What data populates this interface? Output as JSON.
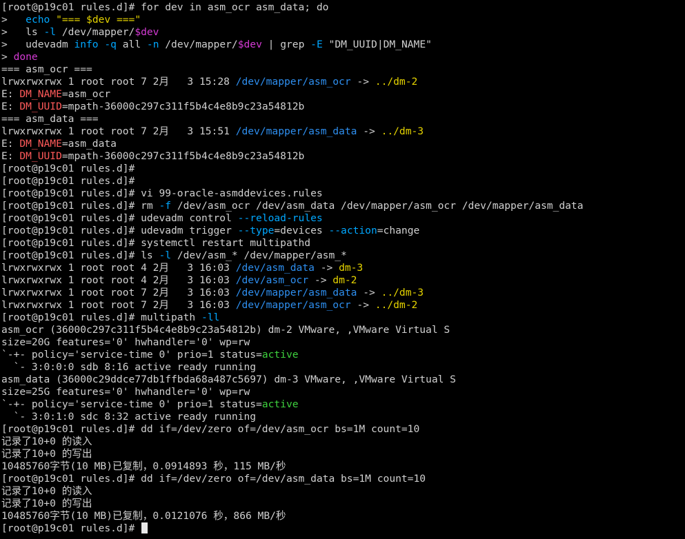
{
  "terminal": {
    "colors": {
      "background": "#000000",
      "default": "#d0d0d0",
      "cyan": "#00a7ff",
      "yellow": "#e6d400",
      "magenta": "#d43bd4",
      "red": "#ff5a5a",
      "green": "#3ed23e",
      "path": "#2e8ff0"
    },
    "lines": [
      [
        {
          "t": "[root@p19c01 rules.d]# for dev in asm_ocr asm_data; do",
          "c": "default"
        }
      ],
      [
        {
          "t": ">   ",
          "c": "default"
        },
        {
          "t": "echo",
          "c": "cyan"
        },
        {
          "t": " ",
          "c": "default"
        },
        {
          "t": "\"=== $dev ===\"",
          "c": "yellow"
        }
      ],
      [
        {
          "t": ">   ls ",
          "c": "default"
        },
        {
          "t": "-l",
          "c": "cyan"
        },
        {
          "t": " /dev/mapper/",
          "c": "default"
        },
        {
          "t": "$dev",
          "c": "magenta"
        }
      ],
      [
        {
          "t": ">   udevadm ",
          "c": "default"
        },
        {
          "t": "info",
          "c": "cyan"
        },
        {
          "t": " ",
          "c": "default"
        },
        {
          "t": "-q",
          "c": "cyan"
        },
        {
          "t": " all ",
          "c": "default"
        },
        {
          "t": "-n",
          "c": "cyan"
        },
        {
          "t": " /dev/mapper/",
          "c": "default"
        },
        {
          "t": "$dev",
          "c": "magenta"
        },
        {
          "t": " | grep ",
          "c": "default"
        },
        {
          "t": "-E",
          "c": "cyan"
        },
        {
          "t": " \"DM_UUID|DM_NAME\"",
          "c": "default"
        }
      ],
      [
        {
          "t": "> ",
          "c": "default"
        },
        {
          "t": "done",
          "c": "magenta"
        }
      ],
      [
        {
          "t": "=== asm_ocr ===",
          "c": "default"
        }
      ],
      [
        {
          "t": "lrwxrwxrwx 1 root root 7 2月   3 15:28 ",
          "c": "default"
        },
        {
          "t": "/dev/mapper/asm_ocr",
          "c": "path"
        },
        {
          "t": " -> ",
          "c": "default"
        },
        {
          "t": "../dm-2",
          "c": "yellow"
        }
      ],
      [
        {
          "t": "E: ",
          "c": "default"
        },
        {
          "t": "DM_NAME",
          "c": "red"
        },
        {
          "t": "=asm_ocr",
          "c": "default"
        }
      ],
      [
        {
          "t": "E: ",
          "c": "default"
        },
        {
          "t": "DM_UUID",
          "c": "red"
        },
        {
          "t": "=mpath-36000c297c311f5b4c4e8b9c23a54812b",
          "c": "default"
        }
      ],
      [
        {
          "t": "=== asm_data ===",
          "c": "default"
        }
      ],
      [
        {
          "t": "lrwxrwxrwx 1 root root 7 2月   3 15:51 ",
          "c": "default"
        },
        {
          "t": "/dev/mapper/asm_data",
          "c": "path"
        },
        {
          "t": " -> ",
          "c": "default"
        },
        {
          "t": "../dm-3",
          "c": "yellow"
        }
      ],
      [
        {
          "t": "E: ",
          "c": "default"
        },
        {
          "t": "DM_NAME",
          "c": "red"
        },
        {
          "t": "=asm_data",
          "c": "default"
        }
      ],
      [
        {
          "t": "E: ",
          "c": "default"
        },
        {
          "t": "DM_UUID",
          "c": "red"
        },
        {
          "t": "=mpath-36000c297c311f5b4c4e8b9c23a54812b",
          "c": "default"
        }
      ],
      [
        {
          "t": "[root@p19c01 rules.d]#",
          "c": "default"
        }
      ],
      [
        {
          "t": "[root@p19c01 rules.d]#",
          "c": "default"
        }
      ],
      [
        {
          "t": "[root@p19c01 rules.d]# vi 99-oracle-asmddevices.rules",
          "c": "default"
        }
      ],
      [
        {
          "t": "[root@p19c01 rules.d]# rm ",
          "c": "default"
        },
        {
          "t": "-f",
          "c": "cyan"
        },
        {
          "t": " /dev/asm_ocr /dev/asm_data /dev/mapper/asm_ocr /dev/mapper/asm_data",
          "c": "default"
        }
      ],
      [
        {
          "t": "[root@p19c01 rules.d]# udevadm control ",
          "c": "default"
        },
        {
          "t": "--reload-rules",
          "c": "cyan"
        }
      ],
      [
        {
          "t": "[root@p19c01 rules.d]# udevadm trigger ",
          "c": "default"
        },
        {
          "t": "--type",
          "c": "cyan"
        },
        {
          "t": "=devices ",
          "c": "default"
        },
        {
          "t": "--action",
          "c": "cyan"
        },
        {
          "t": "=change",
          "c": "default"
        }
      ],
      [
        {
          "t": "[root@p19c01 rules.d]# systemctl restart multipathd",
          "c": "default"
        }
      ],
      [
        {
          "t": "[root@p19c01 rules.d]# ls ",
          "c": "default"
        },
        {
          "t": "-l",
          "c": "cyan"
        },
        {
          "t": " /dev/asm_* /dev/mapper/asm_*",
          "c": "default"
        }
      ],
      [
        {
          "t": "lrwxrwxrwx 1 root root 4 2月   3 16:03 ",
          "c": "default"
        },
        {
          "t": "/dev/asm_data",
          "c": "path"
        },
        {
          "t": " -> ",
          "c": "default"
        },
        {
          "t": "dm-3",
          "c": "yellow"
        }
      ],
      [
        {
          "t": "lrwxrwxrwx 1 root root 4 2月   3 16:03 ",
          "c": "default"
        },
        {
          "t": "/dev/asm_ocr",
          "c": "path"
        },
        {
          "t": " -> ",
          "c": "default"
        },
        {
          "t": "dm-2",
          "c": "yellow"
        }
      ],
      [
        {
          "t": "lrwxrwxrwx 1 root root 7 2月   3 16:03 ",
          "c": "default"
        },
        {
          "t": "/dev/mapper/asm_data",
          "c": "path"
        },
        {
          "t": " -> ",
          "c": "default"
        },
        {
          "t": "../dm-3",
          "c": "yellow"
        }
      ],
      [
        {
          "t": "lrwxrwxrwx 1 root root 7 2月   3 16:03 ",
          "c": "default"
        },
        {
          "t": "/dev/mapper/asm_ocr",
          "c": "path"
        },
        {
          "t": " -> ",
          "c": "default"
        },
        {
          "t": "../dm-2",
          "c": "yellow"
        }
      ],
      [
        {
          "t": "[root@p19c01 rules.d]# multipath ",
          "c": "default"
        },
        {
          "t": "-ll",
          "c": "cyan"
        }
      ],
      [
        {
          "t": "asm_ocr (36000c297c311f5b4c4e8b9c23a54812b) dm-2 VMware, ,VMware Virtual S",
          "c": "default"
        }
      ],
      [
        {
          "t": "size=20G features='0' hwhandler='0' wp=rw",
          "c": "default"
        }
      ],
      [
        {
          "t": "`-+- policy='service-time 0' prio=1 status=",
          "c": "default"
        },
        {
          "t": "active",
          "c": "green"
        }
      ],
      [
        {
          "t": "  `- 3:0:0:0 sdb 8:16 active ready running",
          "c": "default"
        }
      ],
      [
        {
          "t": "asm_data (36000c29ddce77db1ffbda68a487c5697) dm-3 VMware, ,VMware Virtual S",
          "c": "default"
        }
      ],
      [
        {
          "t": "size=25G features='0' hwhandler='0' wp=rw",
          "c": "default"
        }
      ],
      [
        {
          "t": "`-+- policy='service-time 0' prio=1 status=",
          "c": "default"
        },
        {
          "t": "active",
          "c": "green"
        }
      ],
      [
        {
          "t": "  `- 3:0:1:0 sdc 8:32 active ready running",
          "c": "default"
        }
      ],
      [
        {
          "t": "[root@p19c01 rules.d]# dd if=/dev/zero of=/dev/asm_ocr bs=1M count=10",
          "c": "default"
        }
      ],
      [
        {
          "t": "记录了10+0 的读入",
          "c": "default"
        }
      ],
      [
        {
          "t": "记录了10+0 的写出",
          "c": "default"
        }
      ],
      [
        {
          "t": "10485760字节(10 MB)已复制，0.0914893 秒，115 MB/秒",
          "c": "default"
        }
      ],
      [
        {
          "t": "[root@p19c01 rules.d]# dd if=/dev/zero of=/dev/asm_data bs=1M count=10",
          "c": "default"
        }
      ],
      [
        {
          "t": "记录了10+0 的读入",
          "c": "default"
        }
      ],
      [
        {
          "t": "记录了10+0 的写出",
          "c": "default"
        }
      ],
      [
        {
          "t": "10485760字节(10 MB)已复制，0.0121076 秒，866 MB/秒",
          "c": "default"
        }
      ],
      [
        {
          "t": "[root@p19c01 rules.d]# ",
          "c": "default"
        }
      ]
    ],
    "cursor_visible": true
  }
}
